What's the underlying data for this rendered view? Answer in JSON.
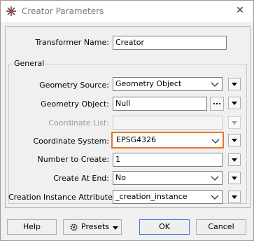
{
  "window": {
    "title": "Creator Parameters",
    "close_glyph": "✕"
  },
  "fields": {
    "transformer_name": {
      "label": "Transformer Name:",
      "value": "Creator"
    },
    "group_title": "General",
    "geometry_source": {
      "label": "Geometry Source:",
      "value": "Geometry Object"
    },
    "geometry_object": {
      "label": "Geometry Object:",
      "value": "Null",
      "dots": "..."
    },
    "coordinate_list": {
      "label": "Coordinate List:",
      "value": ""
    },
    "coordinate_system": {
      "label": "Coordinate System:",
      "value": "EPSG4326",
      "highlight_color": "#e8742a"
    },
    "number_to_create": {
      "label": "Number to Create:",
      "value": "1"
    },
    "create_at_end": {
      "label": "Create At End:",
      "value": "No"
    },
    "creation_instance_attribute": {
      "label": "Creation Instance Attribute:",
      "value": "_creation_instance"
    }
  },
  "buttons": {
    "help": "Help",
    "presets": "Presets",
    "ok": "OK",
    "cancel": "Cancel"
  },
  "icons": {
    "app": "fme-creator-icon",
    "close": "close-icon",
    "presets": "gear-icon",
    "dropdown": "chevron-down-icon",
    "menu": "triangle-down-icon"
  }
}
